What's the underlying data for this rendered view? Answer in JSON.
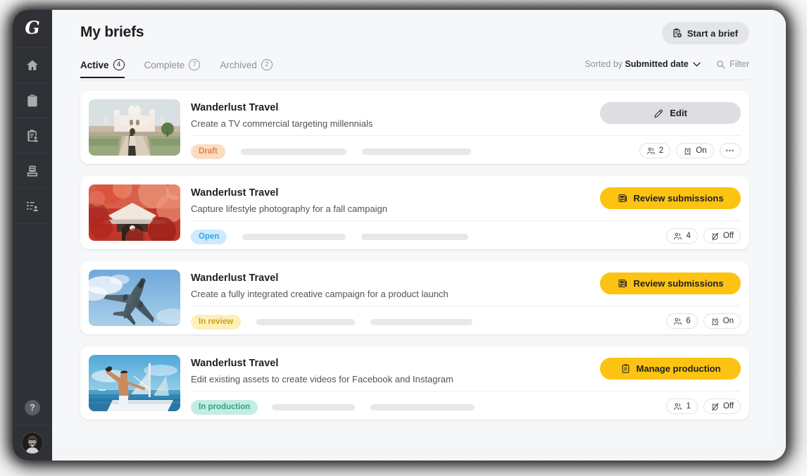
{
  "app": {
    "brand_logo": "G",
    "rail_items": [
      {
        "name": "home",
        "icon": "home-icon"
      },
      {
        "name": "briefs",
        "icon": "clipboard-icon"
      },
      {
        "name": "submissions",
        "icon": "clipboard-person-icon"
      },
      {
        "name": "library",
        "icon": "archive-icon"
      },
      {
        "name": "talent",
        "icon": "list-person-icon"
      }
    ],
    "help_label": "?",
    "avatar_label": "user-avatar"
  },
  "header": {
    "title": "My briefs",
    "start_brief_label": "Start a brief",
    "start_brief_icon": "clipboard-plus-icon"
  },
  "tabs": [
    {
      "label": "Active",
      "count": "4",
      "active": true
    },
    {
      "label": "Complete",
      "count": "7",
      "active": false
    },
    {
      "label": "Archived",
      "count": "2",
      "active": false
    }
  ],
  "toolbar": {
    "sorted_by_prefix": "Sorted by",
    "sorted_by_value": "Submitted date",
    "chevron": "⌄",
    "filter_label": "Filter",
    "filter_icon": "search-icon"
  },
  "colors": {
    "accent_yellow": "#fdc312",
    "rail_bg": "#2f3136",
    "page_bg": "#f6f7f9",
    "draft_bg": "#fbdcc2",
    "draft_fg": "#e8803c",
    "open_bg": "#cfeafc",
    "open_fg": "#2aa8ef",
    "inreview_bg": "#fdf0b8",
    "inreview_fg": "#c9a21a",
    "inproduction_bg": "#c5ece3",
    "inproduction_fg": "#2aa58c"
  },
  "cards": [
    {
      "title": "Wanderlust Travel",
      "description": "Create a TV commercial targeting millennials",
      "status": "Draft",
      "status_style": "draft",
      "thumb": "palace",
      "action": {
        "label": "Edit",
        "icon": "pencil-icon",
        "style": "grey"
      },
      "chips": [
        {
          "icon": "people-icon",
          "label": "2"
        },
        {
          "icon": "alarm-on-icon",
          "label": "On"
        },
        {
          "icon": "more-icon",
          "label": "•••"
        }
      ]
    },
    {
      "title": "Wanderlust Travel",
      "description": "Capture lifestyle photography for a fall campaign",
      "status": "Open",
      "status_style": "open",
      "thumb": "temple",
      "action": {
        "label": "Review submissions",
        "icon": "submissions-icon",
        "style": "yellow"
      },
      "chips": [
        {
          "icon": "people-icon",
          "label": "4"
        },
        {
          "icon": "alarm-off-icon",
          "label": "Off"
        }
      ]
    },
    {
      "title": "Wanderlust Travel",
      "description": "Create a fully integrated creative campaign for a product launch",
      "status": "In review",
      "status_style": "inreview",
      "thumb": "airplane",
      "action": {
        "label": "Review submissions",
        "icon": "submissions-icon",
        "style": "yellow"
      },
      "chips": [
        {
          "icon": "people-icon",
          "label": "6"
        },
        {
          "icon": "alarm-on-icon",
          "label": "On"
        }
      ]
    },
    {
      "title": "Wanderlust Travel",
      "description": "Edit existing assets to create videos for Facebook and Instagram",
      "status": "In production",
      "status_style": "inproduction",
      "thumb": "sailboat",
      "action": {
        "label": "Manage production",
        "icon": "clipboard-icon",
        "style": "yellow"
      },
      "chips": [
        {
          "icon": "people-icon",
          "label": "1"
        },
        {
          "icon": "alarm-off-icon",
          "label": "Off"
        }
      ]
    }
  ]
}
